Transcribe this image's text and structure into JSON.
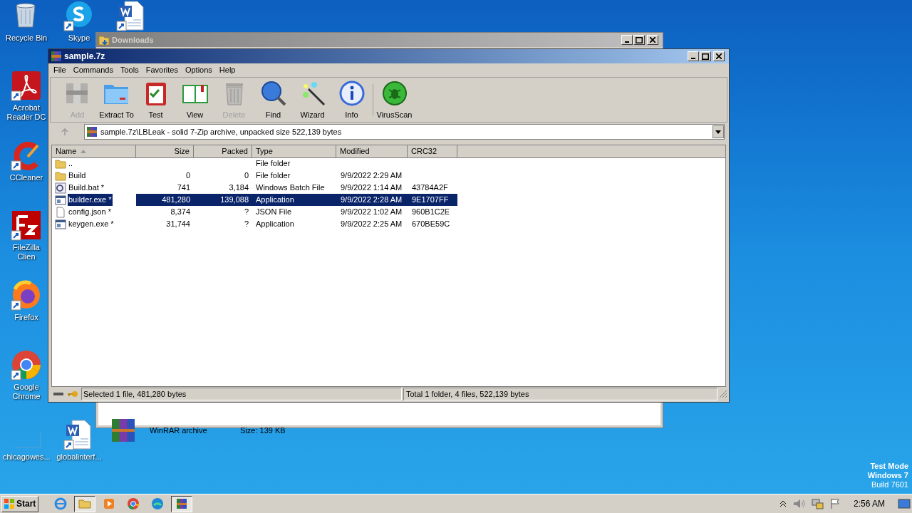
{
  "desktop_icons": [
    {
      "label": "Recycle Bin",
      "kind": "bin"
    },
    {
      "label": "Skype",
      "kind": "skype"
    },
    {
      "kind": "word"
    },
    {
      "label": "Acrobat Reader DC",
      "kind": "acrobat"
    },
    {
      "label": "CCleaner",
      "kind": "ccleaner"
    },
    {
      "label": "FileZilla Clien",
      "kind": "filezilla"
    },
    {
      "label": "Firefox",
      "kind": "firefox"
    },
    {
      "label": "Google Chrome",
      "kind": "chrome"
    },
    {
      "label": "chicagowes...",
      "kind": "blank"
    },
    {
      "label": "globalinterf...",
      "kind": "word"
    }
  ],
  "background_window": {
    "title": "Downloads",
    "item_type": "WinRAR archive",
    "item_size": "Size: 139 KB"
  },
  "archive_window": {
    "title": "sample.7z",
    "menu": [
      "File",
      "Commands",
      "Tools",
      "Favorites",
      "Options",
      "Help"
    ],
    "toolbar": [
      {
        "label": "Add",
        "disabled": true
      },
      {
        "label": "Extract To",
        "disabled": false
      },
      {
        "label": "Test",
        "disabled": false
      },
      {
        "label": "View",
        "disabled": false
      },
      {
        "label": "Delete",
        "disabled": true
      },
      {
        "label": "Find",
        "disabled": false
      },
      {
        "label": "Wizard",
        "disabled": false
      },
      {
        "label": "Info",
        "disabled": false
      },
      {
        "label": "VirusScan",
        "disabled": false
      }
    ],
    "address": "sample.7z\\LBLeak - solid 7-Zip archive, unpacked size 522,139 bytes",
    "columns": [
      "Name",
      "Size",
      "Packed",
      "Type",
      "Modified",
      "CRC32"
    ],
    "rows": [
      {
        "kind": "folder",
        "name": "..",
        "size": "",
        "packed": "",
        "type": "File folder",
        "modified": "",
        "crc": "",
        "selected": false
      },
      {
        "kind": "folder",
        "name": "Build",
        "size": "0",
        "packed": "0",
        "type": "File folder",
        "modified": "9/9/2022 2:29 AM",
        "crc": "",
        "selected": false
      },
      {
        "kind": "batch",
        "name": "Build.bat *",
        "size": "741",
        "packed": "3,184",
        "type": "Windows Batch File",
        "modified": "9/9/2022 1:14 AM",
        "crc": "43784A2F",
        "selected": false
      },
      {
        "kind": "app",
        "name": "builder.exe *",
        "size": "481,280",
        "packed": "139,088",
        "type": "Application",
        "modified": "9/9/2022 2:28 AM",
        "crc": "9E1707FF",
        "selected": true
      },
      {
        "kind": "file",
        "name": "config.json *",
        "size": "8,374",
        "packed": "?",
        "type": "JSON File",
        "modified": "9/9/2022 1:02 AM",
        "crc": "960B1C2E",
        "selected": false
      },
      {
        "kind": "app",
        "name": "keygen.exe *",
        "size": "31,744",
        "packed": "?",
        "type": "Application",
        "modified": "9/9/2022 2:25 AM",
        "crc": "670BE59C",
        "selected": false
      }
    ],
    "status": [
      "Selected 1 file, 481,280 bytes",
      "Total 1 folder, 4 files, 522,139 bytes"
    ]
  },
  "taskbar": {
    "start": "Start",
    "time": "2:56 AM"
  },
  "system_notice": [
    "Test Mode",
    "Windows 7",
    "Build 7601"
  ]
}
